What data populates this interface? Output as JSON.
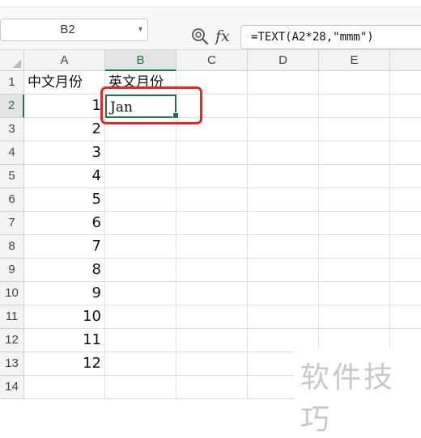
{
  "formula_bar": {
    "name_box": "B2",
    "fx_label": "fx",
    "formula": "=TEXT(A2*28,\"mmm\")"
  },
  "columns": [
    "A",
    "B",
    "C",
    "D",
    "E"
  ],
  "rows": [
    "1",
    "2",
    "3",
    "4",
    "5",
    "6",
    "7",
    "8",
    "9",
    "10",
    "11",
    "12",
    "13",
    "14"
  ],
  "active_cell": "B2",
  "cells": {
    "A1": "中文月份",
    "B1": "英文月份",
    "A2": "1",
    "B2": "Jan",
    "A3": "2",
    "A4": "3",
    "A5": "4",
    "A6": "5",
    "A7": "6",
    "A8": "7",
    "A9": "8",
    "A10": "9",
    "A11": "10",
    "A12": "11",
    "A13": "12"
  },
  "watermark": "软件技巧",
  "colors": {
    "selection_green": "#217346",
    "highlight_red": "#e02a2a"
  },
  "icons": {
    "zoom": "magnifier-zoom-icon",
    "dropdown": "chevron-down-icon",
    "function": "fx-icon"
  }
}
